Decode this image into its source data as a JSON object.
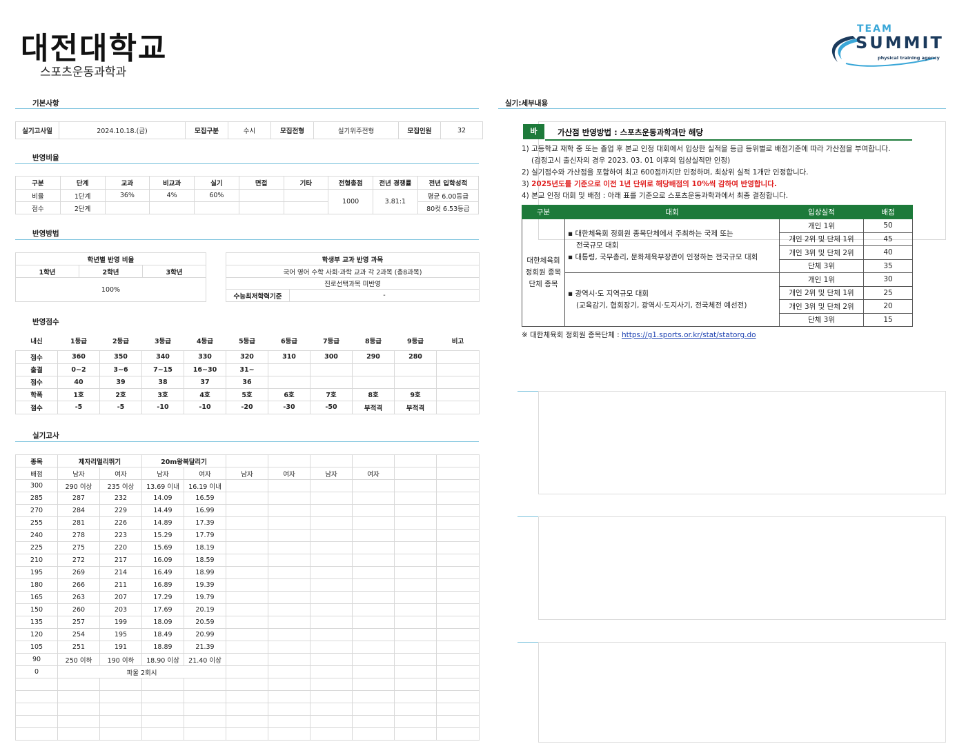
{
  "header": {
    "school": "대전대학교",
    "department": "스포츠운동과학과",
    "logo_team": "TEAM",
    "logo_summit": "SUMMIT",
    "logo_tagline": "physical training agency"
  },
  "sections": {
    "basic": "기본사항",
    "ratio": "반영비율",
    "method": "반영방법",
    "score": "반영점수",
    "practical": "실기고사",
    "detail": "실기:세부내용"
  },
  "basic": {
    "date_label": "실기고사일",
    "date": "2024.10.18.(금)",
    "type_label": "모집구분",
    "type": "수시",
    "track_label": "모집전형",
    "track": "실기위주전형",
    "count_label": "모집인원",
    "count": "32"
  },
  "ratio": {
    "headers": [
      "구분",
      "단계",
      "교과",
      "비교과",
      "실기",
      "면접",
      "기타",
      "전형총점",
      "전년 경쟁률",
      "전년 입학성적"
    ],
    "row1": [
      "비율",
      "1단계",
      "36%",
      "4%",
      "60%"
    ],
    "row2": [
      "점수",
      "2단계"
    ],
    "total": "1000",
    "competition": "3.81:1",
    "prev1": "평균 6.00등급",
    "prev2": "80컷 6.53등급"
  },
  "method": {
    "grade_title": "학년별 반영 비율",
    "grade_headers": [
      "1학년",
      "2학년",
      "3학년"
    ],
    "grade_value": "100%",
    "subject_title": "학생부 교과 반영 과목",
    "subject_line1": "국어 영어 수학 사회·과학 교과 각 2과목 (총8과목)",
    "subject_line2": "진로선택과목 미반영",
    "min_label": "수능최저학력기준",
    "min_value": "-"
  },
  "score": {
    "headers": [
      "내신",
      "1등급",
      "2등급",
      "3등급",
      "4등급",
      "5등급",
      "6등급",
      "7등급",
      "8등급",
      "9등급",
      "비고"
    ],
    "rows": [
      [
        "점수",
        "360",
        "350",
        "340",
        "330",
        "320",
        "310",
        "300",
        "290",
        "280",
        ""
      ],
      [
        "출결",
        "0~2",
        "3~6",
        "7~15",
        "16~30",
        "31~",
        "",
        "",
        "",
        "",
        ""
      ],
      [
        "점수",
        "40",
        "39",
        "38",
        "37",
        "36",
        "",
        "",
        "",
        "",
        ""
      ],
      [
        "학폭",
        "1호",
        "2호",
        "3호",
        "4호",
        "5호",
        "6호",
        "7호",
        "8호",
        "9호",
        ""
      ],
      [
        "점수",
        "-5",
        "-5",
        "-10",
        "-10",
        "-20",
        "-30",
        "-50",
        "부적격",
        "부적격",
        ""
      ]
    ]
  },
  "practical": {
    "event_label": "종목",
    "event1": "제자리멀리뛰기",
    "event2": "20m왕복달리기",
    "sub": [
      "배점",
      "남자",
      "여자",
      "남자",
      "여자",
      "남자",
      "여자",
      "남자",
      "여자",
      "",
      ""
    ],
    "rows": [
      [
        "300",
        "290 이상",
        "235 이상",
        "13.69 이내",
        "16.19 이내"
      ],
      [
        "285",
        "287",
        "232",
        "14.09",
        "16.59"
      ],
      [
        "270",
        "284",
        "229",
        "14.49",
        "16.99"
      ],
      [
        "255",
        "281",
        "226",
        "14.89",
        "17.39"
      ],
      [
        "240",
        "278",
        "223",
        "15.29",
        "17.79"
      ],
      [
        "225",
        "275",
        "220",
        "15.69",
        "18.19"
      ],
      [
        "210",
        "272",
        "217",
        "16.09",
        "18.59"
      ],
      [
        "195",
        "269",
        "214",
        "16.49",
        "18.99"
      ],
      [
        "180",
        "266",
        "211",
        "16.89",
        "19.39"
      ],
      [
        "165",
        "263",
        "207",
        "17.29",
        "19.79"
      ],
      [
        "150",
        "260",
        "203",
        "17.69",
        "20.19"
      ],
      [
        "135",
        "257",
        "199",
        "18.09",
        "20.59"
      ],
      [
        "120",
        "254",
        "195",
        "18.49",
        "20.99"
      ],
      [
        "105",
        "251",
        "191",
        "18.89",
        "21.39"
      ],
      [
        "90",
        "250 이하",
        "190 이하",
        "18.90 이상",
        "21.40 이상"
      ]
    ],
    "foul_score": "0",
    "foul_text": "파울 2회시"
  },
  "detail": {
    "badge": "바",
    "title": "가산점 반영방법 : 스포츠운동과학과만 해당",
    "line1": "1) 고등학교 재학 중 또는 졸업 후 본교 인정 대회에서 입상한 실적을 등급 등위별로 배점기준에 따라 가산점을 부여합니다.",
    "line1b": "(검정고시 출신자의 경우 2023. 03. 01 이후의 입상실적만 인정)",
    "line2": "2) 실기점수와 가산점을 포함하여 최고 600점까지만 인정하며, 최상위 실적 1개만 인정합니다.",
    "line3_prefix": "3) ",
    "line3": "2025년도를 기준으로 이전 1년 단위로 해당배점의 10%씩 감하여 반영합니다.",
    "line4": "4) 본교 인정 대회 및 배점 : 아래 표를 기준으로 스포츠운동과학과에서 최종 결정합니다.",
    "table_headers": [
      "구분",
      "대회",
      "입상실적",
      "배점"
    ],
    "category": "대한체육회 정회원 종목단체 종목",
    "comp1a": "▪ 대한체육회 정회원 종목단체에서 주최하는 국제 또는",
    "comp1b": "전국규모 대회",
    "comp1c": "▪ 대통령, 국무총리, 문화체육부장관이 인정하는 전국규모 대회",
    "comp2a": "▪ 광역시·도 지역규모 대회",
    "comp2b": "(교육감기, 협회장기, 광역시·도지사기, 전국체전 예선전)",
    "results": [
      [
        "개인 1위",
        "50"
      ],
      [
        "개인 2위 및 단체 1위",
        "45"
      ],
      [
        "개인 3위 및 단체 2위",
        "40"
      ],
      [
        "단체 3위",
        "35"
      ],
      [
        "개인 1위",
        "30"
      ],
      [
        "개인 2위 및 단체 1위",
        "25"
      ],
      [
        "개인 3위 및 단체 2위",
        "20"
      ],
      [
        "단체 3위",
        "15"
      ]
    ],
    "footnote_prefix": "※ 대한체육회 정회원 종목단체 : ",
    "footnote_link": "https://g1.sports.or.kr/stat/statorg.do"
  }
}
